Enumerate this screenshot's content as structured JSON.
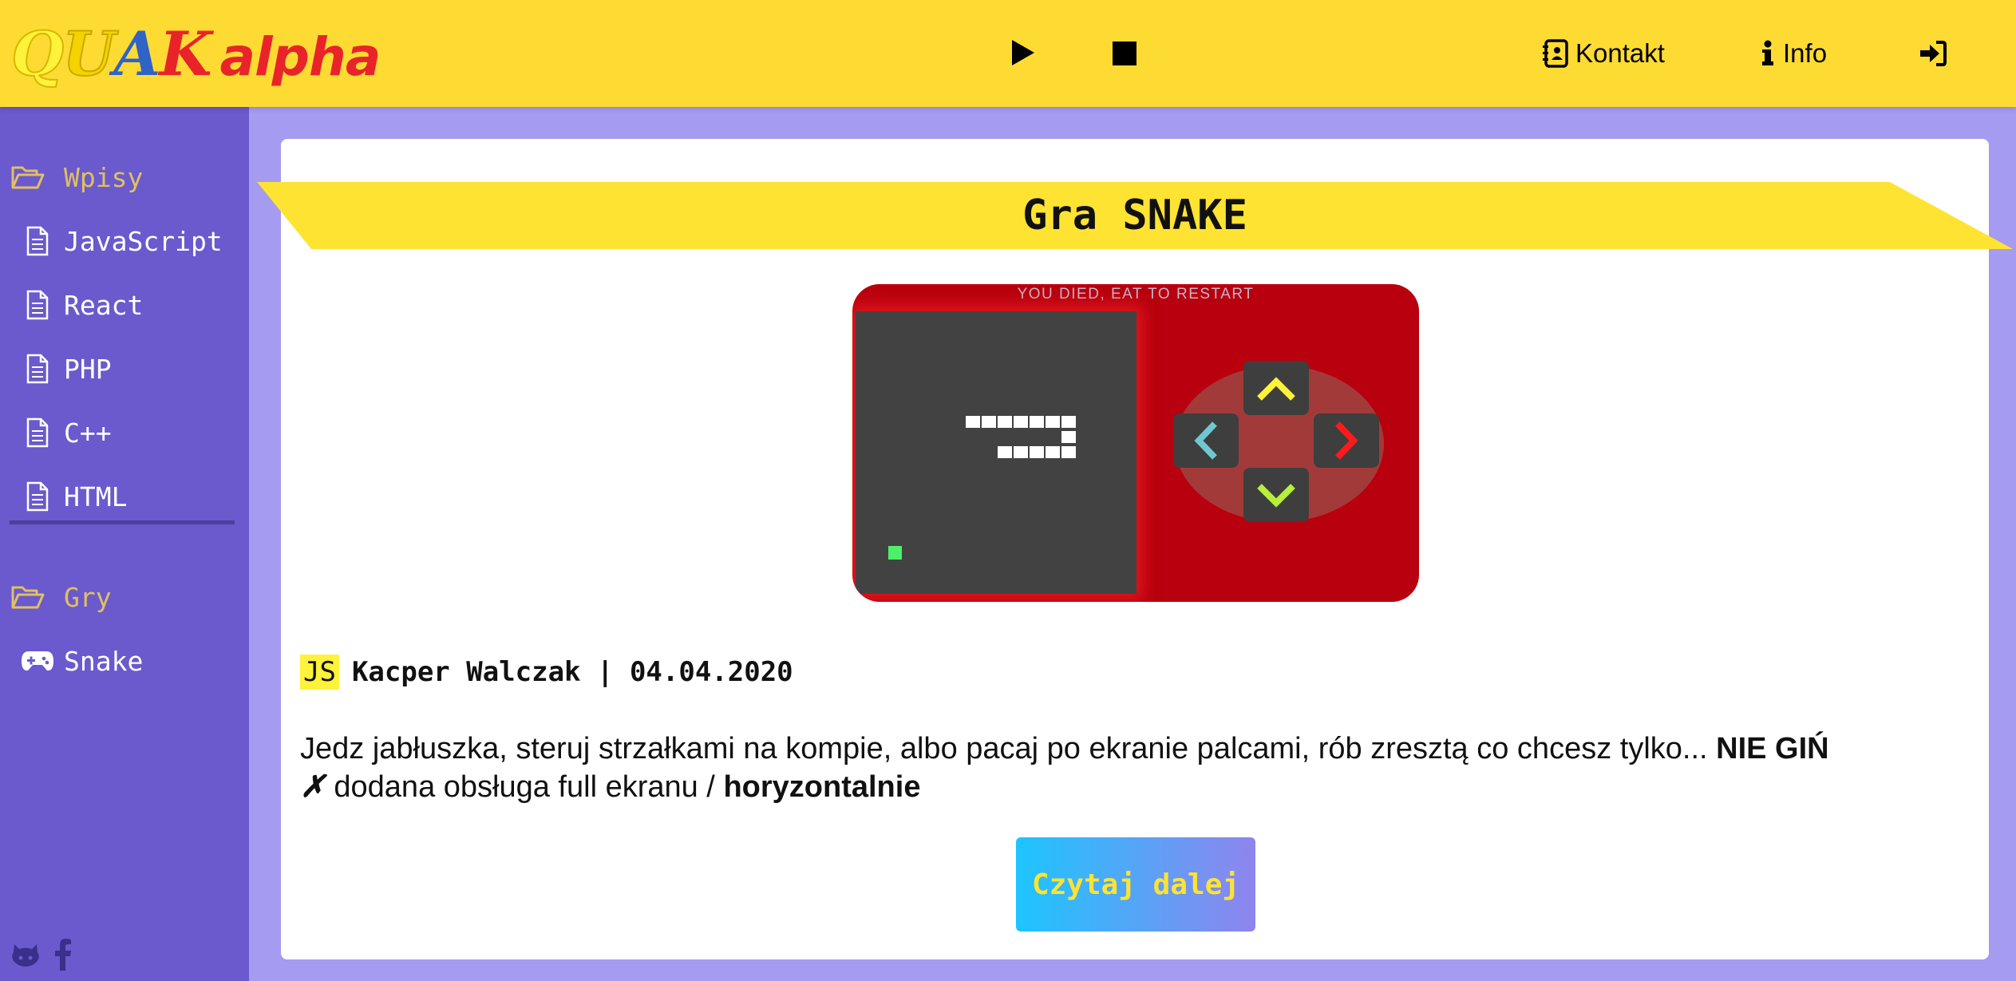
{
  "header": {
    "logo": {
      "q": "Q",
      "u": "U",
      "a": "A",
      "k": "K",
      "alpha": "alpha"
    },
    "nav": {
      "kontakt": "Kontakt",
      "info": "Info"
    }
  },
  "sidebar": {
    "sections": [
      {
        "label": "Wpisy",
        "items": [
          "JavaScript",
          "React",
          "PHP",
          "C++",
          "HTML"
        ]
      },
      {
        "label": "Gry",
        "items": [
          "Snake"
        ]
      }
    ]
  },
  "post": {
    "title": "Gra SNAKE",
    "game": {
      "message": "YOU DIED, EAT TO RESTART"
    },
    "badge": "JS",
    "byline": "Kacper Walczak | 04.04.2020",
    "excerpt_main": "Jedz jabłuszka, steruj strzałkami na kompie, albo pacaj po ekranie palcami, rób zresztą co chcesz tylko... ",
    "excerpt_bold": "NIE GIŃ",
    "excerpt_line2": " dodana obsługa full ekranu / ",
    "excerpt_bold2": "horyzontalnie",
    "read_more": "Czytaj dalej"
  },
  "colors": {
    "header": "#fedb33",
    "sidebar": "#6a5acd",
    "background": "#a59bf0",
    "game_body": "#b8000e",
    "arrow_up": "#fff23a",
    "arrow_left": "#6fc8d0",
    "arrow_right": "#ff1a1a",
    "arrow_down": "#b6f03a"
  }
}
